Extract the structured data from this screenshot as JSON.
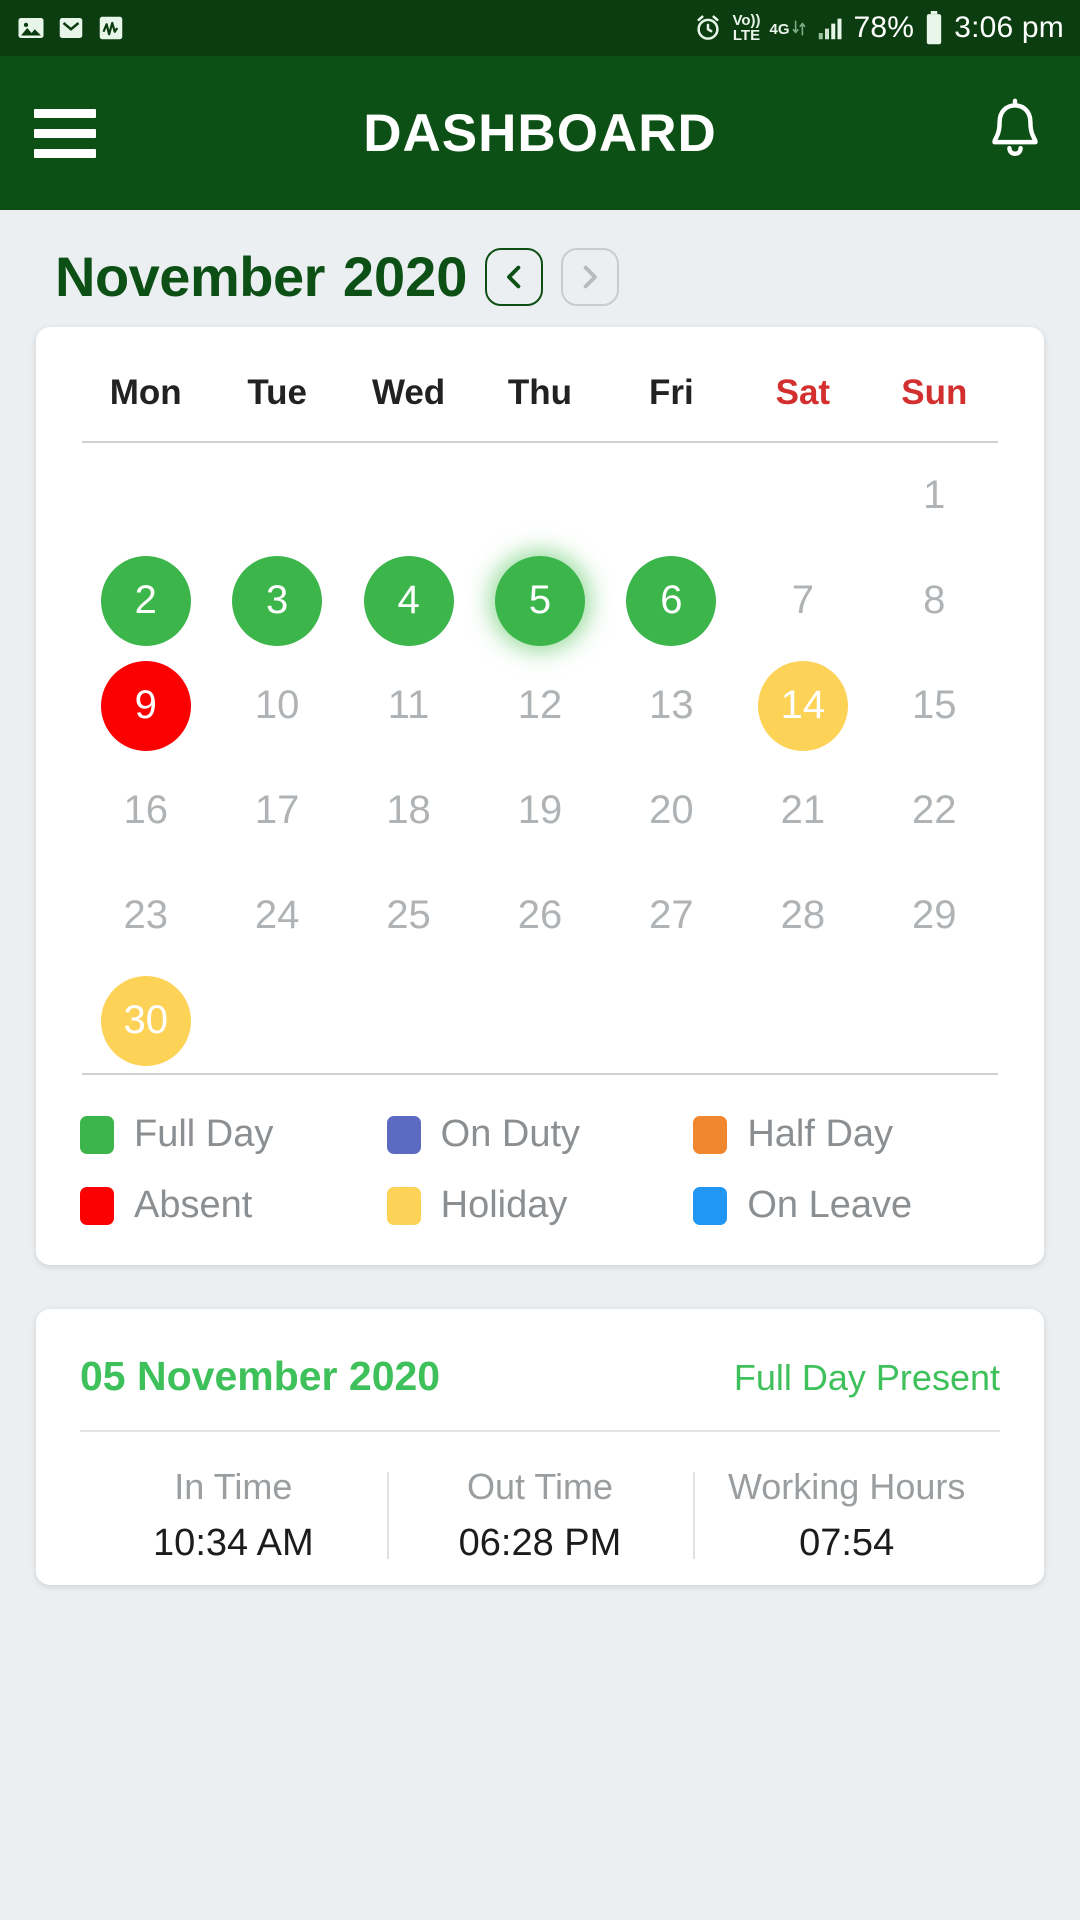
{
  "statusbar": {
    "left_icons": [
      "photo-icon",
      "email-icon",
      "activity-icon"
    ],
    "alarm_icon": "alarm-icon",
    "volte_top": "Vo))",
    "volte_bottom": "LTE",
    "network": "4G",
    "signal_icon": "signal-bars-icon",
    "battery_percent": "78%",
    "battery_icon": "battery-icon",
    "time": "3:06 pm"
  },
  "appbar": {
    "menu_icon": "hamburger-menu-icon",
    "title": "DASHBOARD",
    "notification_icon": "bell-icon"
  },
  "month_header": {
    "month": "November",
    "year": "2020",
    "prev_label": "‹",
    "next_label": "›",
    "prev_enabled": true,
    "next_enabled": false
  },
  "calendar": {
    "weekdays": [
      {
        "label": "Mon",
        "weekend": false
      },
      {
        "label": "Tue",
        "weekend": false
      },
      {
        "label": "Wed",
        "weekend": false
      },
      {
        "label": "Thu",
        "weekend": false
      },
      {
        "label": "Fri",
        "weekend": false
      },
      {
        "label": "Sat",
        "weekend": true
      },
      {
        "label": "Sun",
        "weekend": true
      }
    ],
    "leading_blanks": 6,
    "days": [
      {
        "n": "1",
        "status": "none"
      },
      {
        "n": "2",
        "status": "full"
      },
      {
        "n": "3",
        "status": "full"
      },
      {
        "n": "4",
        "status": "full"
      },
      {
        "n": "5",
        "status": "full",
        "selected": true
      },
      {
        "n": "6",
        "status": "full"
      },
      {
        "n": "7",
        "status": "none"
      },
      {
        "n": "8",
        "status": "none"
      },
      {
        "n": "9",
        "status": "absent"
      },
      {
        "n": "10",
        "status": "none"
      },
      {
        "n": "11",
        "status": "none"
      },
      {
        "n": "12",
        "status": "none"
      },
      {
        "n": "13",
        "status": "none"
      },
      {
        "n": "14",
        "status": "holiday"
      },
      {
        "n": "15",
        "status": "none"
      },
      {
        "n": "16",
        "status": "none"
      },
      {
        "n": "17",
        "status": "none"
      },
      {
        "n": "18",
        "status": "none"
      },
      {
        "n": "19",
        "status": "none"
      },
      {
        "n": "20",
        "status": "none"
      },
      {
        "n": "21",
        "status": "none"
      },
      {
        "n": "22",
        "status": "none"
      },
      {
        "n": "23",
        "status": "none"
      },
      {
        "n": "24",
        "status": "none"
      },
      {
        "n": "25",
        "status": "none"
      },
      {
        "n": "26",
        "status": "none"
      },
      {
        "n": "27",
        "status": "none"
      },
      {
        "n": "28",
        "status": "none"
      },
      {
        "n": "29",
        "status": "none"
      },
      {
        "n": "30",
        "status": "holiday"
      }
    ],
    "status_colors": {
      "full": "#3CB54B",
      "absent": "#FB0101",
      "holiday": "#FCD257",
      "onduty": "#5C6BC0",
      "halfday": "#F0862E",
      "onleave": "#2196F3",
      "none": ""
    }
  },
  "legend": [
    {
      "label": "Full Day",
      "color": "#3CB54B"
    },
    {
      "label": "On Duty",
      "color": "#5C6BC0"
    },
    {
      "label": "Half Day",
      "color": "#F0862E"
    },
    {
      "label": "Absent",
      "color": "#FB0101"
    },
    {
      "label": "Holiday",
      "color": "#FCD257"
    },
    {
      "label": "On Leave",
      "color": "#2196F3"
    }
  ],
  "detail": {
    "date": "05 November 2020",
    "status": "Full Day Present",
    "stats": [
      {
        "label": "In Time",
        "value": "10:34 AM"
      },
      {
        "label": "Out Time",
        "value": "06:28 PM"
      },
      {
        "label": "Working Hours",
        "value": "07:54"
      }
    ]
  }
}
